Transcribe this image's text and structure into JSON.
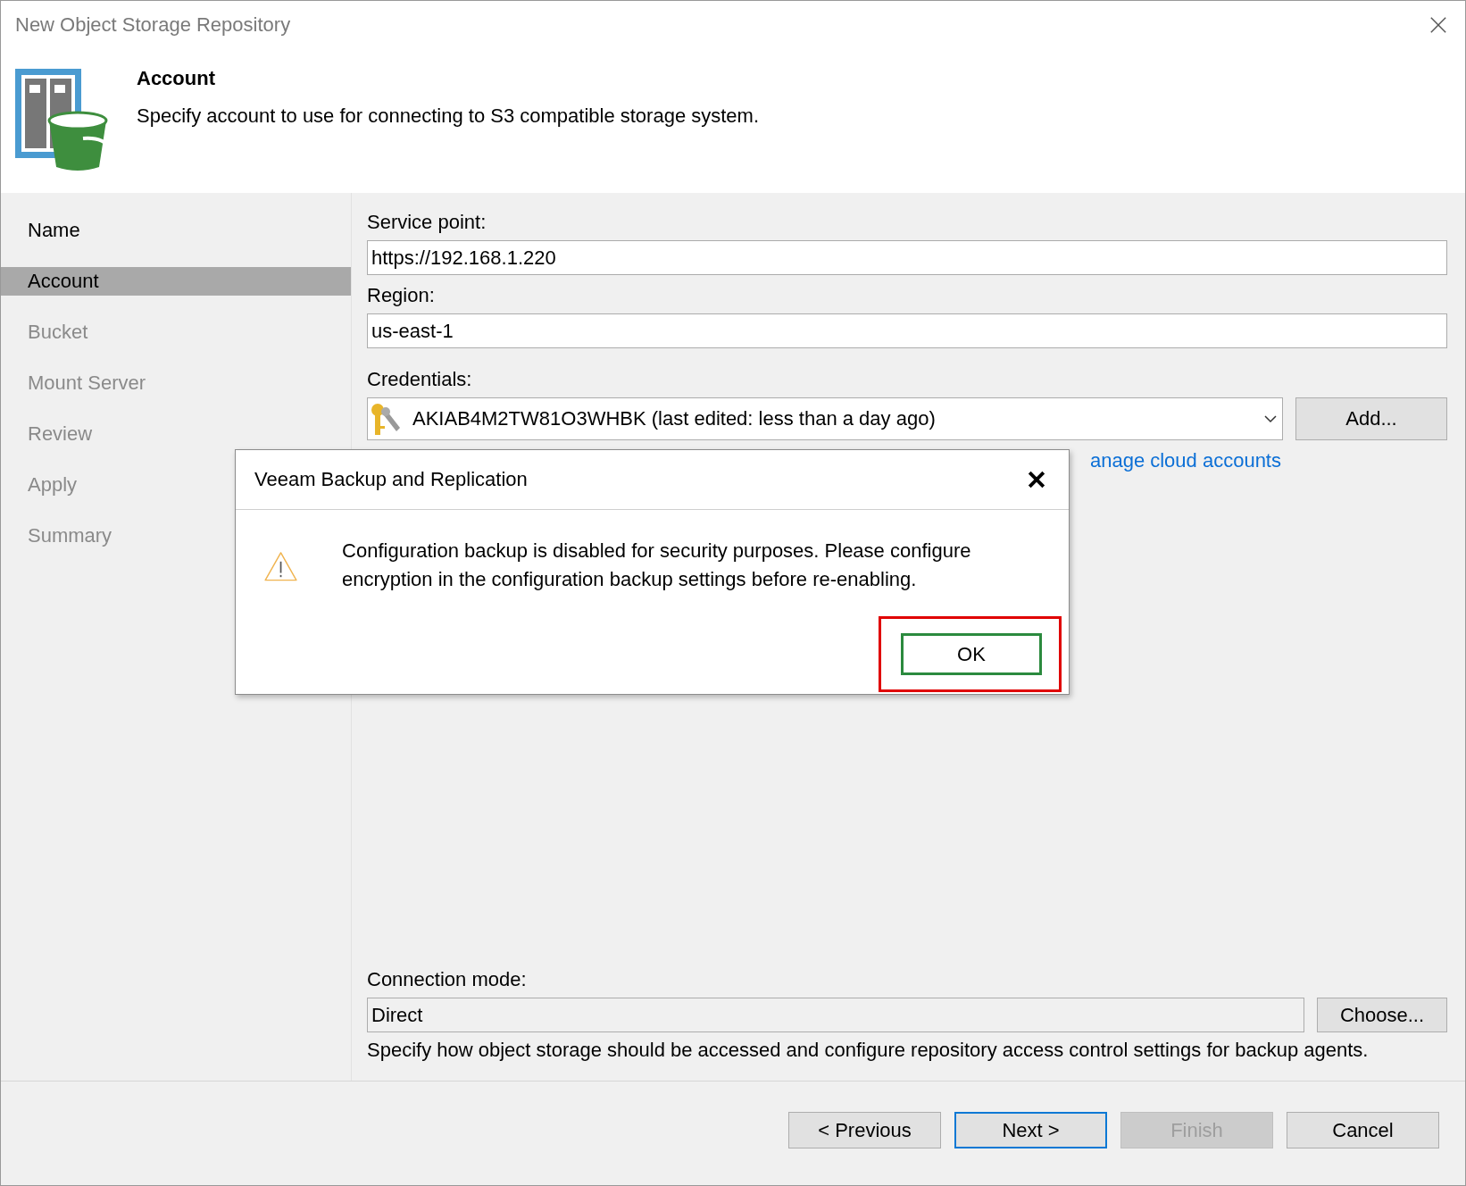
{
  "window": {
    "title": "New Object Storage Repository"
  },
  "header": {
    "title": "Account",
    "subtitle": "Specify account to use for connecting to S3 compatible storage system."
  },
  "sidebar": {
    "items": [
      {
        "label": "Name",
        "selected": false,
        "disabled": false
      },
      {
        "label": "Account",
        "selected": true,
        "disabled": false
      },
      {
        "label": "Bucket",
        "selected": false,
        "disabled": true
      },
      {
        "label": "Mount Server",
        "selected": false,
        "disabled": true
      },
      {
        "label": "Review",
        "selected": false,
        "disabled": true
      },
      {
        "label": "Apply",
        "selected": false,
        "disabled": true
      },
      {
        "label": "Summary",
        "selected": false,
        "disabled": true
      }
    ]
  },
  "form": {
    "service_point": {
      "label": "Service point:",
      "value": "https://192.168.1.220"
    },
    "region": {
      "label": "Region:",
      "value": "us-east-1"
    },
    "credentials": {
      "label": "Credentials:",
      "value": "AKIAB4M2TW81O3WHBK (last edited: less than a day ago)",
      "add_button": "Add...",
      "link": "anage cloud accounts"
    },
    "connection_mode": {
      "label": "Connection mode:",
      "value": "Direct",
      "choose_button": "Choose...",
      "description": "Specify how object storage should be accessed and configure repository access control settings for backup agents."
    }
  },
  "footer": {
    "buttons": [
      {
        "label": "< Previous",
        "disabled": false,
        "focused": false
      },
      {
        "label": "Next >",
        "disabled": false,
        "focused": true
      },
      {
        "label": "Finish",
        "disabled": true,
        "focused": false
      },
      {
        "label": "Cancel",
        "disabled": false,
        "focused": false
      }
    ]
  },
  "dialog": {
    "title": "Veeam Backup and Replication",
    "message": "Configuration backup is disabled for security purposes. Please configure encryption in the configuration backup settings before re-enabling.",
    "ok_button": {
      "label": "OK",
      "highlighted": true
    }
  }
}
